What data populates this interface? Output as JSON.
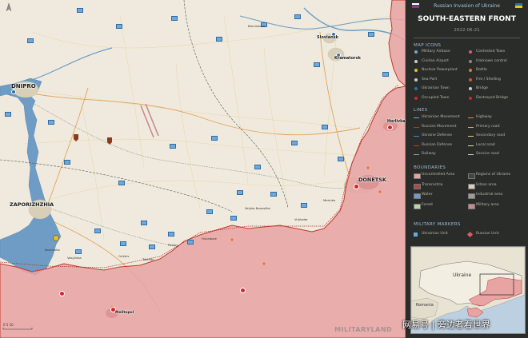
{
  "header": {
    "title": "Russian Invasion of Ukraine",
    "subtitle": "SOUTH-EASTERN FRONT",
    "date": "2022-06-21"
  },
  "legend": {
    "map_icons_heading": "MAP ICONS",
    "map_icons": [
      {
        "label": "Military Airbase",
        "icon": "airbase-icon"
      },
      {
        "label": "Contested Town",
        "icon": "contested-town-icon"
      },
      {
        "label": "Civilian Airport",
        "icon": "airport-icon"
      },
      {
        "label": "Unknown control",
        "icon": "unknown-control-icon"
      },
      {
        "label": "Nuclear Powerplant",
        "icon": "nuclear-icon"
      },
      {
        "label": "Battle",
        "icon": "battle-icon"
      },
      {
        "label": "Sea Port",
        "icon": "anchor-icon"
      },
      {
        "label": "Fire / Shelling",
        "icon": "fire-icon"
      },
      {
        "label": "Ukrainian Town",
        "icon": "ukrainian-town-icon"
      },
      {
        "label": "Bridge",
        "icon": "bridge-icon"
      },
      {
        "label": "Occupied Town",
        "icon": "occupied-town-icon"
      },
      {
        "label": "Destroyed Bridge",
        "icon": "destroyed-bridge-icon"
      }
    ],
    "lines_heading": "LINES",
    "lines": [
      {
        "label": "Ukrainian Movement",
        "color": "#6fa8dc"
      },
      {
        "label": "Highway",
        "color": "#e0913a"
      },
      {
        "label": "Russian Movement",
        "color": "#d4232f"
      },
      {
        "label": "Primary road",
        "color": "#d9a85a"
      },
      {
        "label": "Ukraine Defense",
        "color": "#4a86c5"
      },
      {
        "label": "Secondary road",
        "color": "#e3cc7a"
      },
      {
        "label": "Russian Defense",
        "color": "#c0392b"
      },
      {
        "label": "Local road",
        "color": "#e8e0b0"
      },
      {
        "label": "Railway",
        "color": "#9a9a9a"
      },
      {
        "label": "Service road",
        "color": "#cfcfcf"
      }
    ],
    "boundaries_heading": "BOUNDARIES",
    "boundaries": [
      {
        "label": "Uncontrolled Area",
        "color": "#e8a3a3"
      },
      {
        "label": "Regions of Ukraine",
        "color": "#444444"
      },
      {
        "label": "Transnistria",
        "color": "#b04a4a"
      },
      {
        "label": "Urban area",
        "color": "#d9cfb8"
      },
      {
        "label": "Water",
        "color": "#6e9cc4"
      },
      {
        "label": "Industrial area",
        "color": "#a49d93"
      },
      {
        "label": "Forest",
        "color": "#b9d6a8"
      },
      {
        "label": "Military area",
        "color": "#c98a8a"
      }
    ],
    "military_heading": "MILITARY MARKERS",
    "military": [
      {
        "label": "Ukrainian Unit",
        "color": "#6fa8dc"
      },
      {
        "label": "Russian Unit",
        "color": "#e05a6a"
      }
    ]
  },
  "cities": [
    {
      "name": "DNIPRO"
    },
    {
      "name": "ZAPORIZHZHIA"
    },
    {
      "name": "DONETSK"
    },
    {
      "name": "Kramatorsk"
    },
    {
      "name": "Sloviansk"
    },
    {
      "name": "Horlivka"
    },
    {
      "name": "Melitopol"
    }
  ],
  "towns": [
    "Barvinkove",
    "Velyka Novosilka",
    "Vuhledar",
    "Marinka",
    "Orikhiv",
    "Tokmak",
    "Polohy",
    "Huliaipole",
    "Vasylivka",
    "Kamianka"
  ],
  "inset": {
    "labels": [
      "Ukraine",
      "Romania"
    ]
  },
  "watermark": {
    "brand": "MILITARYLAND",
    "overlay": "网易号 | 旁边者看世界"
  },
  "colors": {
    "occupied": "#e8a3a3",
    "water": "#6e9cc4",
    "land": "#efeadd",
    "panel": "#2a2c2a"
  }
}
